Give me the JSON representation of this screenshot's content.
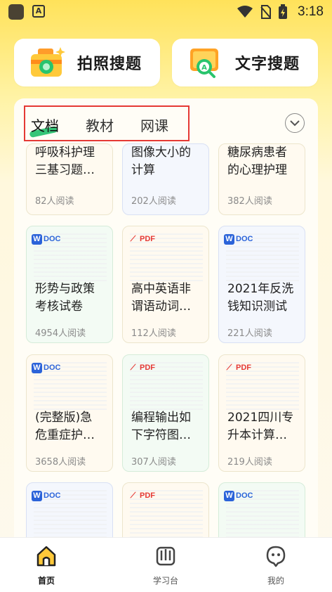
{
  "status_bar": {
    "time": "3:18"
  },
  "search": {
    "photo_label": "拍照搜题",
    "text_label": "文字搜题"
  },
  "tabs": [
    {
      "label": "文档",
      "active": true
    },
    {
      "label": "教材",
      "active": false
    },
    {
      "label": "网课",
      "active": false
    }
  ],
  "docs": [
    {
      "type": "",
      "title": "呼吸科护理\n三基习题…",
      "reads": "82人阅读",
      "tint": "yellow"
    },
    {
      "type": "",
      "title": "图像大小的\n计算",
      "reads": "202人阅读",
      "tint": "blue"
    },
    {
      "type": "",
      "title": "糖尿病患者\n的心理护理",
      "reads": "382人阅读",
      "tint": "yellow"
    },
    {
      "type": "DOC",
      "title": "形势与政策\n考核试卷",
      "reads": "4954人阅读",
      "tint": "green"
    },
    {
      "type": "PDF",
      "title": "高中英语非\n谓语动词…",
      "reads": "112人阅读",
      "tint": "yellow"
    },
    {
      "type": "DOC",
      "title": "2021年反洗\n钱知识测试",
      "reads": "221人阅读",
      "tint": "blue"
    },
    {
      "type": "DOC",
      "title": "(完整版)急\n危重症护…",
      "reads": "3658人阅读",
      "tint": "yellow"
    },
    {
      "type": "PDF",
      "title": "编程输出如\n下字符图…",
      "reads": "307人阅读",
      "tint": "green"
    },
    {
      "type": "PDF",
      "title": "2021四川专\n升本计算…",
      "reads": "219人阅读",
      "tint": "yellow"
    },
    {
      "type": "DOC",
      "title": "",
      "reads": "",
      "tint": "blue"
    },
    {
      "type": "PDF",
      "title": "",
      "reads": "",
      "tint": "yellow"
    },
    {
      "type": "DOC",
      "title": "",
      "reads": "",
      "tint": "green"
    }
  ],
  "nav": [
    {
      "label": "首页",
      "icon": "home-icon",
      "active": true
    },
    {
      "label": "学习台",
      "icon": "book-icon",
      "active": false
    },
    {
      "label": "我的",
      "icon": "profile-icon",
      "active": false
    }
  ],
  "colors": {
    "accent_red": "#e53935",
    "tab_underline": "#1fbf6a",
    "doc_blue": "#2b63d9",
    "header_yellow": "#ffe25a"
  }
}
